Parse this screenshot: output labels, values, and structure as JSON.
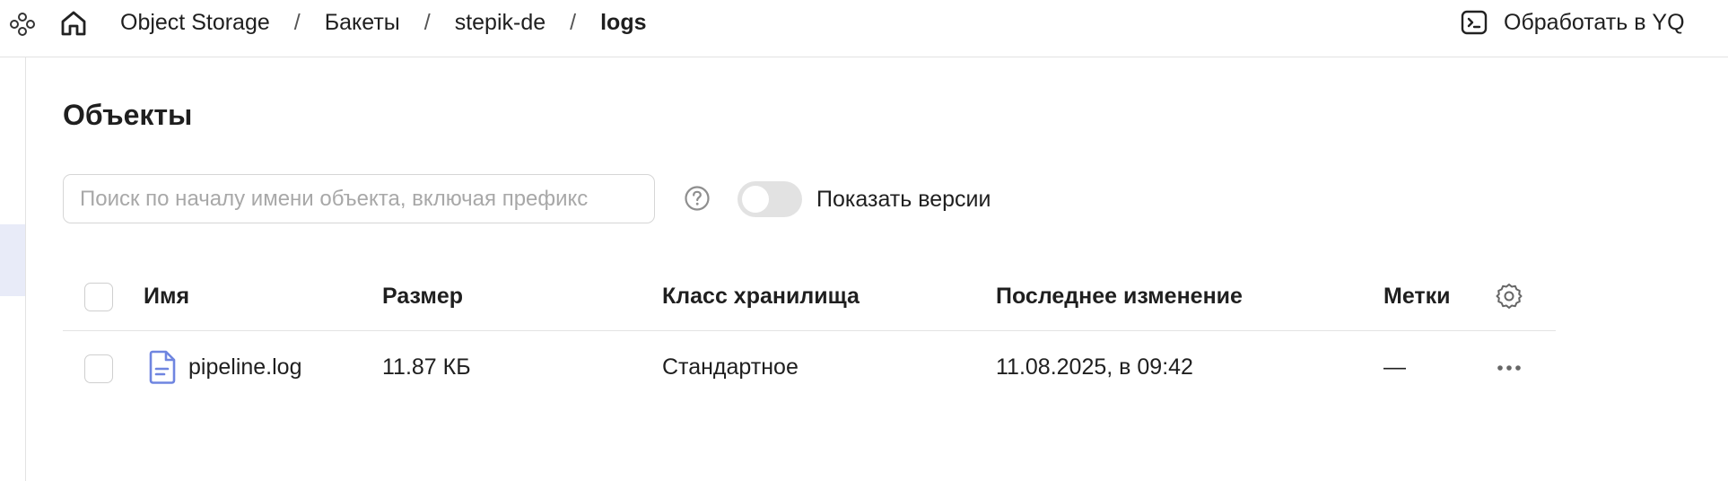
{
  "header": {
    "breadcrumb": [
      {
        "label": "Object Storage"
      },
      {
        "label": "Бакеты"
      },
      {
        "label": "stepik-de"
      },
      {
        "label": "logs"
      }
    ],
    "separator": "/",
    "yq_button_label": "Обработать в YQ",
    "icons": {
      "service": "service-nodes-icon",
      "home": "home-icon",
      "yq": "terminal-icon"
    }
  },
  "main": {
    "title": "Объекты",
    "search": {
      "placeholder": "Поиск по началу имени объекта, включая префикс",
      "value": ""
    },
    "help_icon": "question-circle-icon",
    "show_versions": {
      "label": "Показать версии",
      "enabled": false
    }
  },
  "table": {
    "columns": {
      "name": "Имя",
      "size": "Размер",
      "storage_class": "Класс хранилища",
      "modified": "Последнее изменение",
      "tags": "Метки"
    },
    "rows": [
      {
        "name": "pipeline.log",
        "size": "11.87 КБ",
        "storage_class": "Стандартное",
        "modified": "11.08.2025, в 09:42",
        "tags": "—"
      }
    ]
  },
  "colors": {
    "accent": "#6f85e0",
    "toggle_off": "#e2e2e2",
    "active_rail": "#e8ebf8",
    "border": "#e3e3e3"
  }
}
